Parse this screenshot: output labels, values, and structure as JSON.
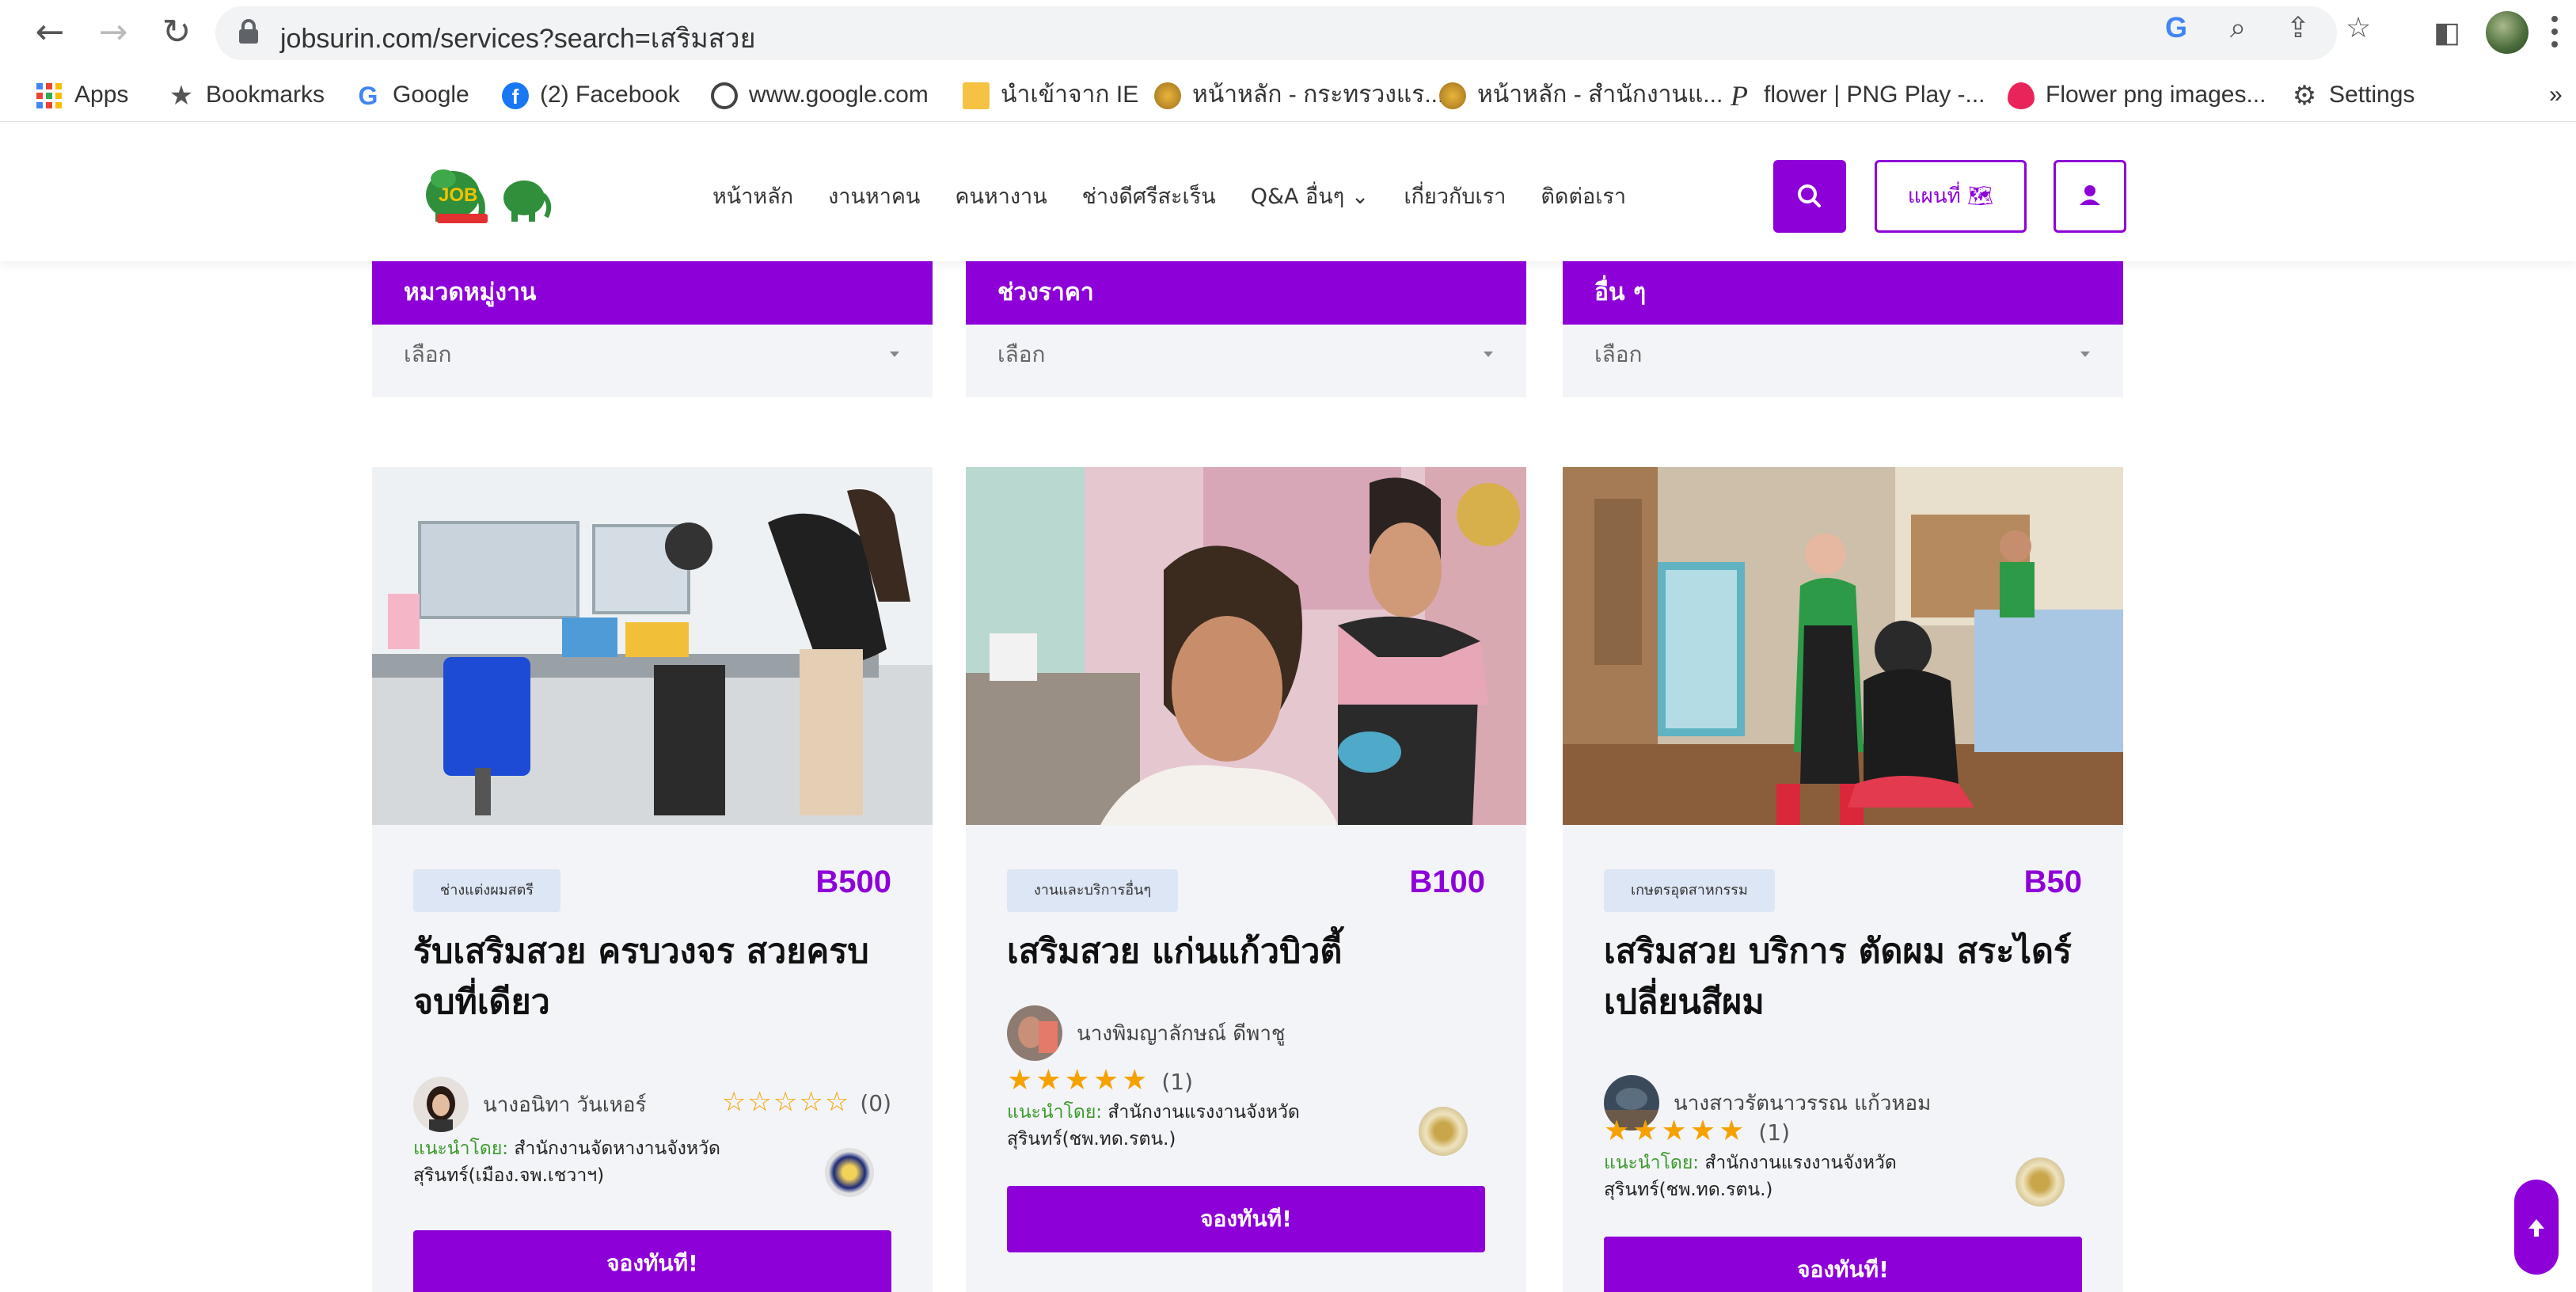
{
  "browser": {
    "url": "jobsurin.com/services?search=เสริมสวย",
    "bookmarks": [
      {
        "label": "Apps",
        "icon": "apps-grid-icon"
      },
      {
        "label": "Bookmarks",
        "icon": "star-icon"
      },
      {
        "label": "Google",
        "icon": "google-icon"
      },
      {
        "label": "(2) Facebook",
        "icon": "facebook-icon"
      },
      {
        "label": "www.google.com",
        "icon": "globe-icon"
      },
      {
        "label": "นำเข้าจาก IE",
        "icon": "folder-icon"
      },
      {
        "label": "หน้าหลัก - กระทรวงแร...",
        "icon": "seal-icon"
      },
      {
        "label": "หน้าหลัก - สำนักงานแ...",
        "icon": "seal-icon"
      },
      {
        "label": "flower | PNG Play -...",
        "icon": "p-icon"
      },
      {
        "label": "Flower png images...",
        "icon": "drop-icon"
      },
      {
        "label": "Settings",
        "icon": "gear-icon"
      }
    ],
    "overflow": "»"
  },
  "site": {
    "nav": [
      "หน้าหลัก",
      "งานหาคน",
      "คนหางาน",
      "ช่างดีศรีสะเร็น",
      "Q&A อื่นๆ ⌄",
      "เกี่ยวกับเรา",
      "ติดต่อเรา"
    ],
    "map_button": "แผนที่ 🗺",
    "accent": "#8e00d8"
  },
  "filters": [
    {
      "header": "หมวดหมู่งาน",
      "value": "เลือก"
    },
    {
      "header": "ช่วงราคา",
      "value": "เลือก"
    },
    {
      "header": "อื่น ๆ",
      "value": "เลือก"
    }
  ],
  "cards": [
    {
      "category": "ช่างแต่งผมสตรี",
      "price": "B500",
      "title": "รับเสริมสวย ครบวงจร สวยครบ จบที่เดียว",
      "person": "นางอนิทา วันเหอร์",
      "stars": "☆☆☆☆☆",
      "rating_count": "(0)",
      "rec_label": "แนะนำโดย:",
      "rec_text": "สำนักงานจัดหางานจังหวัดสุรินทร์(เมือง.จพ.เชวาฯ)",
      "button": "จองทันที!"
    },
    {
      "category": "งานและบริการอื่นๆ",
      "price": "B100",
      "title": "เสริมสวย แก่นแก้วบิวตี้",
      "person": "นางพิมญาลักษณ์ ดีพาชู",
      "stars": "★★★★★",
      "rating_count": "(1)",
      "rec_label": "แนะนำโดย:",
      "rec_text": "สำนักงานแรงงานจังหวัดสุรินทร์(ชพ.ทด.รตน.)",
      "button": "จองทันที!"
    },
    {
      "category": "เกษตรอุตสาหกรรม",
      "price": "B50",
      "title": "เสริมสวย บริการ ตัดผม สระไดร์ เปลี่ยนสีผม",
      "person": "นางสาวรัตนาวรรณ แก้วหอม",
      "stars": "★★★★★",
      "rating_count": "(1)",
      "rec_label": "แนะนำโดย:",
      "rec_text": "สำนักงานแรงงานจังหวัดสุรินทร์(ชพ.ทด.รตน.)",
      "button": "จองทันที!"
    }
  ]
}
